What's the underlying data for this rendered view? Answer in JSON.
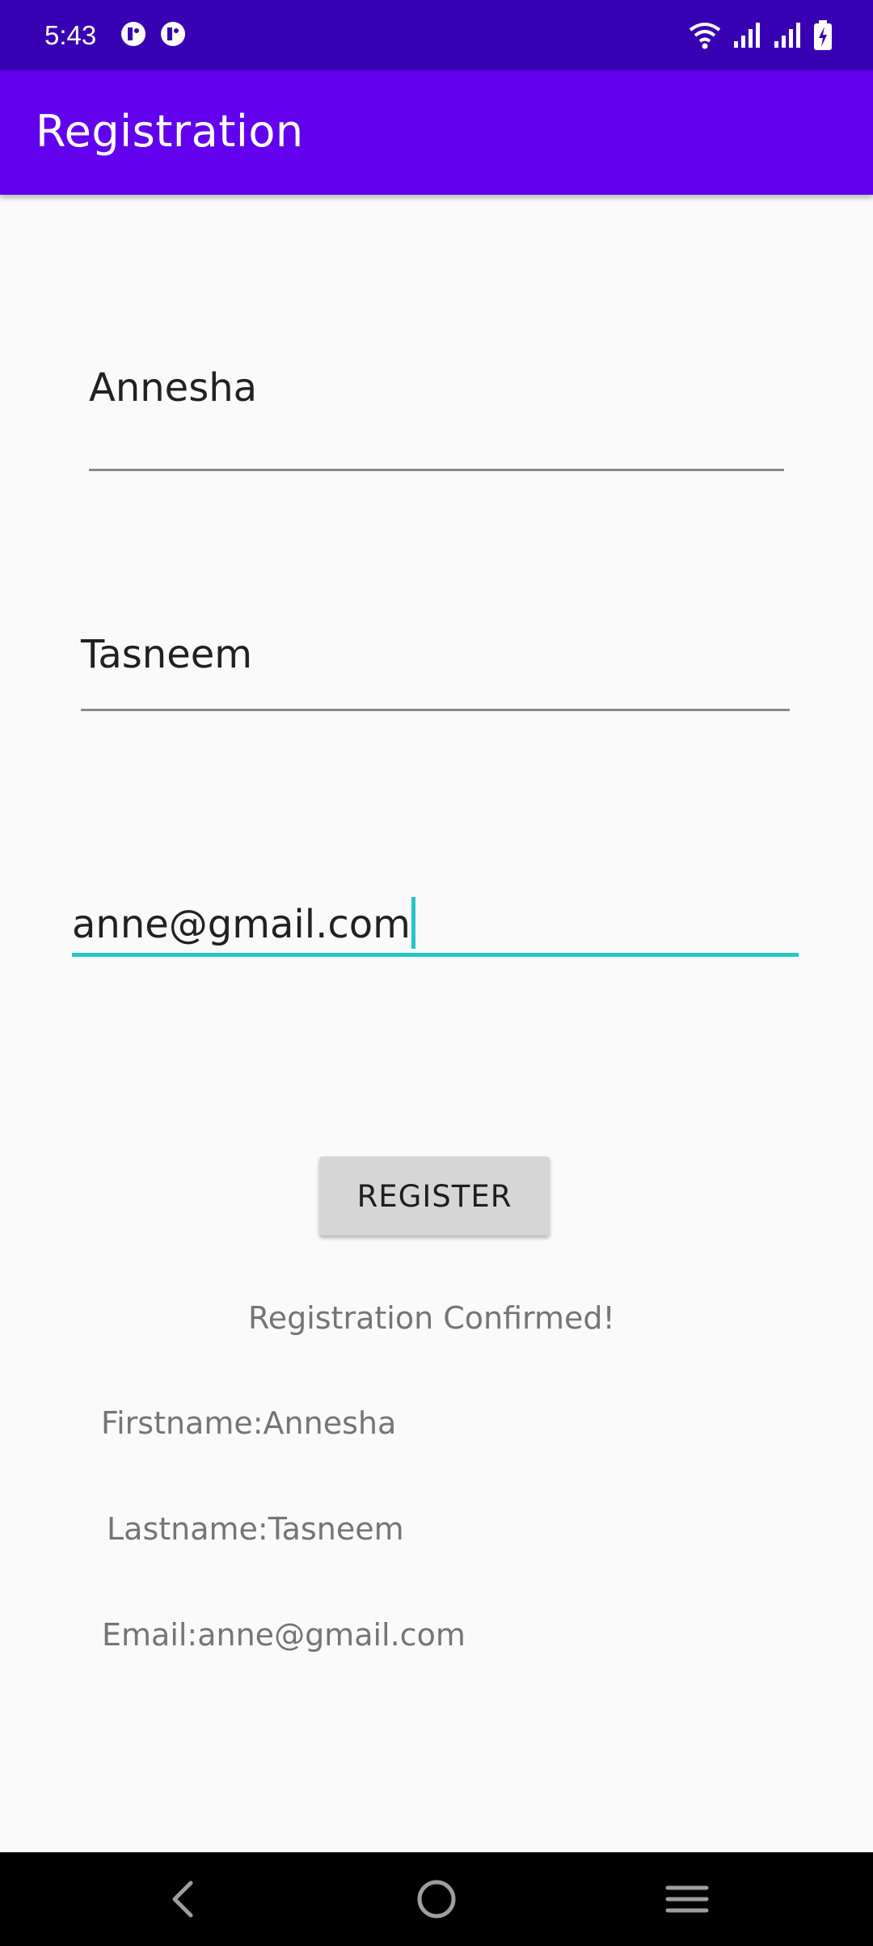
{
  "status_bar": {
    "time": "5:43",
    "icons": [
      "notification-icon",
      "notification-icon",
      "wifi-icon",
      "signal-icon",
      "signal-icon",
      "battery-charging-icon"
    ]
  },
  "app_bar": {
    "title": "Registration"
  },
  "form": {
    "first_name": "Annesha",
    "last_name": "Tasneem",
    "email": "anne@gmail.com"
  },
  "button": {
    "register_label": "REGISTER"
  },
  "result": {
    "confirmation": "Registration Confirmed!",
    "firstname_line": "Firstname:Annesha",
    "lastname_line": "Lastname:Tasneem",
    "email_line": "Email:anne@gmail.com"
  },
  "nav_bar": {
    "icons": [
      "back-icon",
      "home-icon",
      "recents-icon"
    ]
  },
  "colors": {
    "status_bar": "#3700b3",
    "app_bar": "#6200ee",
    "accent": "#26c6c6",
    "background": "#fafafa"
  }
}
